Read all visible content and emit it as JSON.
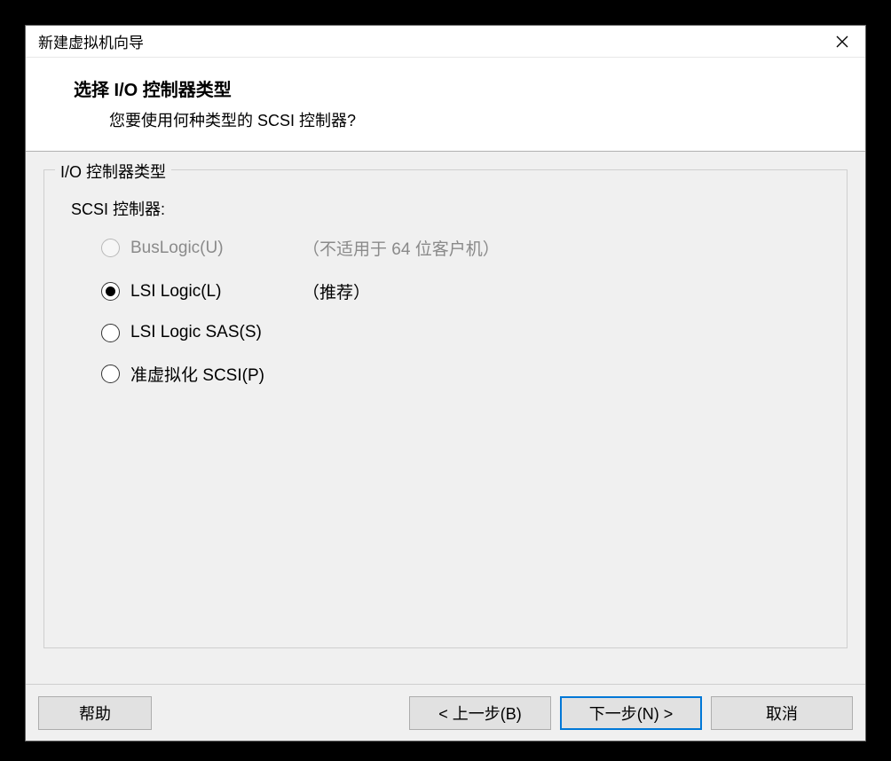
{
  "dialog": {
    "title": "新建虚拟机向导",
    "close_name": "close"
  },
  "header": {
    "title": "选择 I/O 控制器类型",
    "subtitle": "您要使用何种类型的 SCSI 控制器?"
  },
  "fieldset": {
    "legend": "I/O 控制器类型",
    "section_label": "SCSI 控制器:"
  },
  "options": [
    {
      "label": "BusLogic(U)",
      "hint": "（不适用于 64 位客户机）",
      "disabled": true,
      "selected": false
    },
    {
      "label": "LSI Logic(L)",
      "hint": "（推荐）",
      "disabled": false,
      "selected": true
    },
    {
      "label": "LSI Logic SAS(S)",
      "hint": "",
      "disabled": false,
      "selected": false
    },
    {
      "label": "准虚拟化 SCSI(P)",
      "hint": "",
      "disabled": false,
      "selected": false
    }
  ],
  "buttons": {
    "help": "帮助",
    "back": "< 上一步(B)",
    "next": "下一步(N) >",
    "cancel": "取消"
  }
}
